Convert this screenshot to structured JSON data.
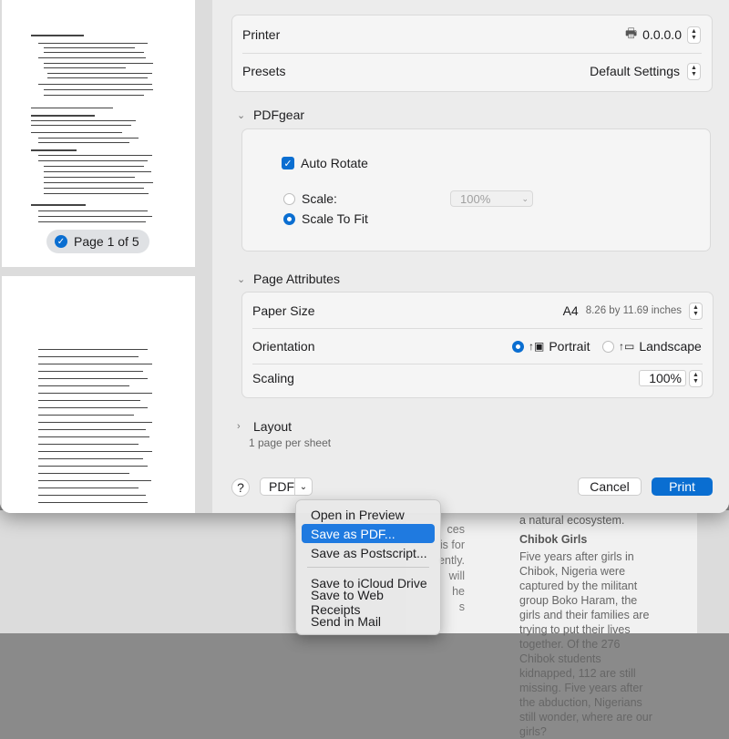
{
  "background_page": {
    "left_fragments": [
      "ces",
      "is for",
      "ently.",
      "",
      "will",
      "he",
      "s"
    ],
    "intro": "a natural ecosystem.",
    "heading": "Chibok Girls",
    "body": "Five years after girls in Chibok, Nigeria were captured by the militant group Boko Haram, the girls and their families are trying to put their lives together. Of the 276 Chibok students kidnapped, 112 are still missing. Five years after the abduction, Nigerians still wonder, where are our girls?"
  },
  "preview": {
    "page_indicator": "Page 1 of 5"
  },
  "printer_card": {
    "printer_label": "Printer",
    "printer_value": "0.0.0.0",
    "presets_label": "Presets",
    "presets_value": "Default Settings"
  },
  "pdfgear": {
    "section_title": "PDFgear",
    "auto_rotate": "Auto Rotate",
    "scale_label": "Scale:",
    "scale_value": "100%",
    "scale_to_fit": "Scale To Fit"
  },
  "page_attributes": {
    "section_title": "Page Attributes",
    "paper_size_label": "Paper Size",
    "paper_size_value": "A4",
    "paper_size_dims": "8.26 by 11.69 inches",
    "orientation_label": "Orientation",
    "portrait": "Portrait",
    "landscape": "Landscape",
    "scaling_label": "Scaling",
    "scaling_value": "100%"
  },
  "layout": {
    "section_title": "Layout",
    "summary": "1 page per sheet"
  },
  "footer": {
    "help": "?",
    "pdf": "PDF",
    "cancel": "Cancel",
    "print": "Print"
  },
  "pdf_menu": {
    "items": [
      "Open in Preview",
      "Save as PDF...",
      "Save as Postscript...",
      "Save to iCloud Drive",
      "Save to Web Receipts",
      "Send in Mail"
    ],
    "selected": "Save as PDF..."
  },
  "colors": {
    "accent": "#0a6ed1",
    "menu_highlight": "#1f7ae0"
  }
}
